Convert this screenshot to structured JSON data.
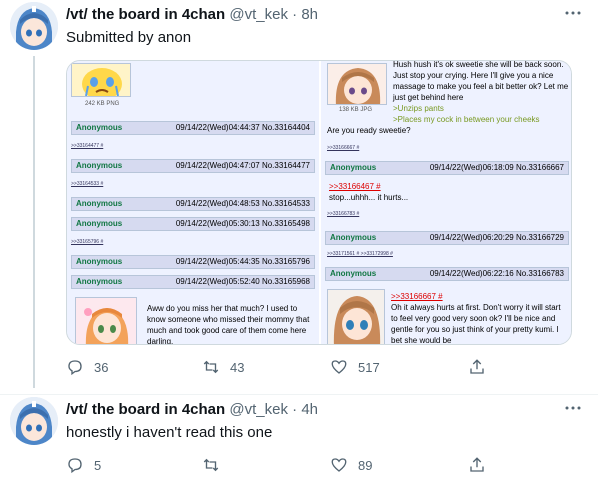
{
  "tweets": [
    {
      "display_name": "/vt/ the board in 4chan",
      "handle": "@vt_kek",
      "time": "8h",
      "dot": "·",
      "text": "Submitted by anon",
      "replies": "36",
      "retweets": "43",
      "likes": "517"
    },
    {
      "display_name": "/vt/ the board in 4chan",
      "handle": "@vt_kek",
      "time": "4h",
      "dot": "·",
      "text": "honestly i haven't read this one",
      "replies": "5",
      "retweets": "",
      "likes": "89"
    }
  ],
  "media": {
    "left": {
      "image_caption": "242 KB PNG",
      "posts": [
        {
          "name": "Anonymous",
          "meta": "09/14/22(Wed)04:44:37 No.33164404",
          "backlink": ">>33164477 #"
        },
        {
          "name": "Anonymous",
          "meta": "09/14/22(Wed)04:47:07 No.33164477",
          "backlink": ">>33164533 #"
        },
        {
          "name": "Anonymous",
          "meta": "09/14/22(Wed)04:48:53 No.33164533",
          "backlink": ""
        },
        {
          "name": "Anonymous",
          "meta": "09/14/22(Wed)05:30:13 No.33165498",
          "backlink": ">>33165796 #"
        },
        {
          "name": "Anonymous",
          "meta": "09/14/22(Wed)05:44:35 No.33165796",
          "backlink": ""
        },
        {
          "name": "Anonymous",
          "meta": "09/14/22(Wed)05:52:40 No.33165968",
          "backlink": ""
        }
      ],
      "last_body": "Aww do you miss her that much? I used to know someone who missed their mommy that much and took good care of them come here darling."
    },
    "right": {
      "image_caption": "138 KB JPG",
      "top_body": "Hush hush it's ok sweetie she will be back soon. Just stop your crying. Here I'll give you a nice massage to make you feel a bit better ok? Let me just get behind here",
      "green1": ">Unzips pants",
      "green2": ">Places my cock in between your cheeks",
      "question": "Are you ready sweetie?",
      "backlink1": ">>33166667 #",
      "posts": [
        {
          "name": "Anonymous",
          "meta": "09/14/22(Wed)06:18:09 No.33166667"
        },
        {
          "name": "Anonymous",
          "meta": "09/14/22(Wed)06:20:29 No.33166729"
        },
        {
          "name": "Anonymous",
          "meta": "09/14/22(Wed)06:22:16 No.33166783"
        }
      ],
      "quote1": ">>33166467 #",
      "reply1": "stop...uhhh... it hurts...",
      "backlink2": ">>33166783 #",
      "backlink3": ">>33171561 #  >>33172998 #",
      "quote2": ">>33166667 #",
      "reply2": "Oh it always hurts at first. Don't worry it will start to feel very good very soon ok? I'll be nice and gentle for you so just think of your pretty kumi. I bet she would be"
    }
  },
  "icons": {
    "reply": "reply-icon",
    "retweet": "retweet-icon",
    "like": "heart-icon",
    "share": "share-icon",
    "more": "more-icon"
  },
  "colors": {
    "text": "#0f1419",
    "muted": "#536471",
    "post_bg": "#d6daf0",
    "board_bg": "#eef2ff",
    "name_green": "#117743",
    "greentext": "#789922",
    "quote_red": "#dd0000"
  }
}
